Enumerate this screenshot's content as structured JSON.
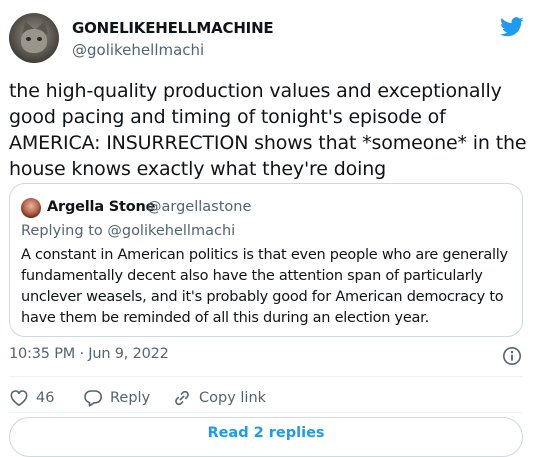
{
  "author": {
    "display_name": "GONELIKEHELLMACHINE",
    "handle": "@golikehellmachi",
    "avatar_icon": "cat-avatar"
  },
  "tweet": {
    "text": "the high-quality production values and exceptionally good pacing and timing of tonight's episode of AMERICA: INSURRECTION shows that *someone* in the house knows exactly what they're doing"
  },
  "quoted_tweet": {
    "display_name": "Argella Stone",
    "handle": "@argellastone",
    "replying_prefix": "Replying to ",
    "replying_to": "@golikehellmachi",
    "text": "A constant in American politics is that even people who are generally fundamentally decent also have the attention span of particularly unclever weasels, and it's probably good for American democracy to have them be reminded of all this during an election year."
  },
  "meta": {
    "timestamp": "10:35 PM · Jun 9, 2022"
  },
  "actions": {
    "like_count": "46",
    "reply_label": "Reply",
    "copy_link_label": "Copy link"
  },
  "footer": {
    "read_replies_label": "Read 2 replies"
  },
  "colors": {
    "twitter_blue": "#1d9bf0",
    "secondary_text": "#536471",
    "border": "#cfd9de"
  }
}
